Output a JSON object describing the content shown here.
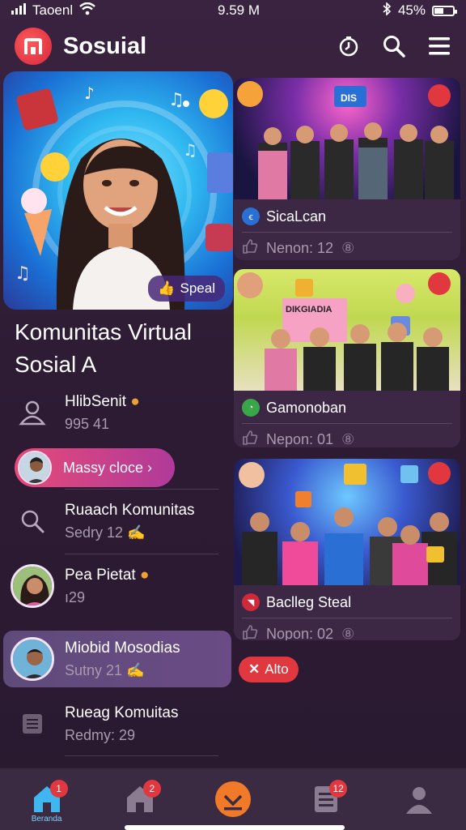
{
  "status_bar": {
    "carrier": "Taoenl",
    "time": "9.59 M",
    "battery": "45%"
  },
  "header": {
    "app_title": "Sosuial"
  },
  "hero": {
    "badge": "Speal"
  },
  "community": {
    "title": "Komunitas Virtual Sosial A"
  },
  "left_list": [
    {
      "title": "HlibSenit",
      "subtitle": "995 41"
    },
    {
      "pill_label": "Massy cloce ›"
    },
    {
      "title": "Ruaach Komunitas",
      "subtitle": "Sedry 12"
    },
    {
      "title": "Pea Pietat",
      "subtitle": "ı29"
    },
    {
      "title": "Miobid Mosodias",
      "subtitle": "Sutny 21"
    },
    {
      "title": "Rueag Komuitas",
      "subtitle": "Redmy: 29"
    }
  ],
  "cards": [
    {
      "banner": "DIS",
      "name": "SicaLcan",
      "stat": "Nenon: 12"
    },
    {
      "banner": "DIKGIADIA",
      "name": "Gamonoban",
      "stat": "Nepon: 01"
    },
    {
      "name": "Baclleg Steal",
      "stat": "Nopon: 02"
    }
  ],
  "alto_button": {
    "label": "Alto"
  },
  "bottom_nav": {
    "items": [
      {
        "badge": "1",
        "label": "Beranda"
      },
      {
        "badge": "2"
      },
      {},
      {
        "badge": "12"
      },
      {}
    ]
  },
  "colors": {
    "accent": "#e0383e",
    "background": "#2c1b33",
    "brand": "#d5283c"
  }
}
